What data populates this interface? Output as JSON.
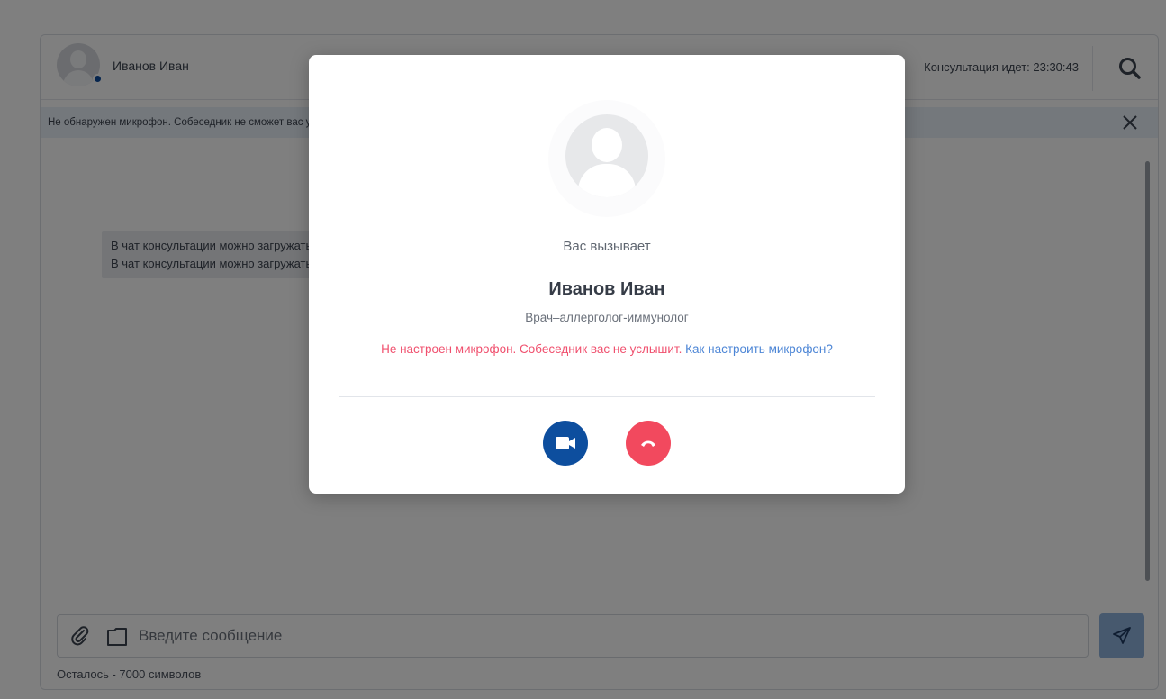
{
  "chat": {
    "contact_name": "Иванов Иван",
    "timer_text": "Консультация идет: 23:30:43",
    "mic_banner": "Не обнаружен микрофон. Собеседник не сможет вас услышать.",
    "system_message": {
      "line1": "В чат консультации можно загружать файлы",
      "line2": "В чат консультации можно загружать файлы"
    },
    "composer": {
      "placeholder": "Введите сообщение",
      "chars_left": "Осталось - 7000 символов"
    }
  },
  "incoming_call": {
    "calling_label": "Вас вызывает",
    "caller_name": "Иванов Иван",
    "caller_role": "Врач–аллерголог-иммунолог",
    "warning_text": "Не настроен микрофон. Собеседник вас не услышит.",
    "help_link": "Как настроить микрофон?"
  },
  "colors": {
    "accent_blue": "#0d4e9e",
    "decline_red": "#f2495e",
    "warning_red": "#f0506e",
    "link_blue": "#4d86d6"
  },
  "icons": {
    "search": "search-icon",
    "close": "close-icon",
    "attach": "paperclip-icon",
    "folder": "folder-icon",
    "send": "send-icon",
    "video": "video-camera-icon",
    "decline": "hang-up-icon"
  }
}
